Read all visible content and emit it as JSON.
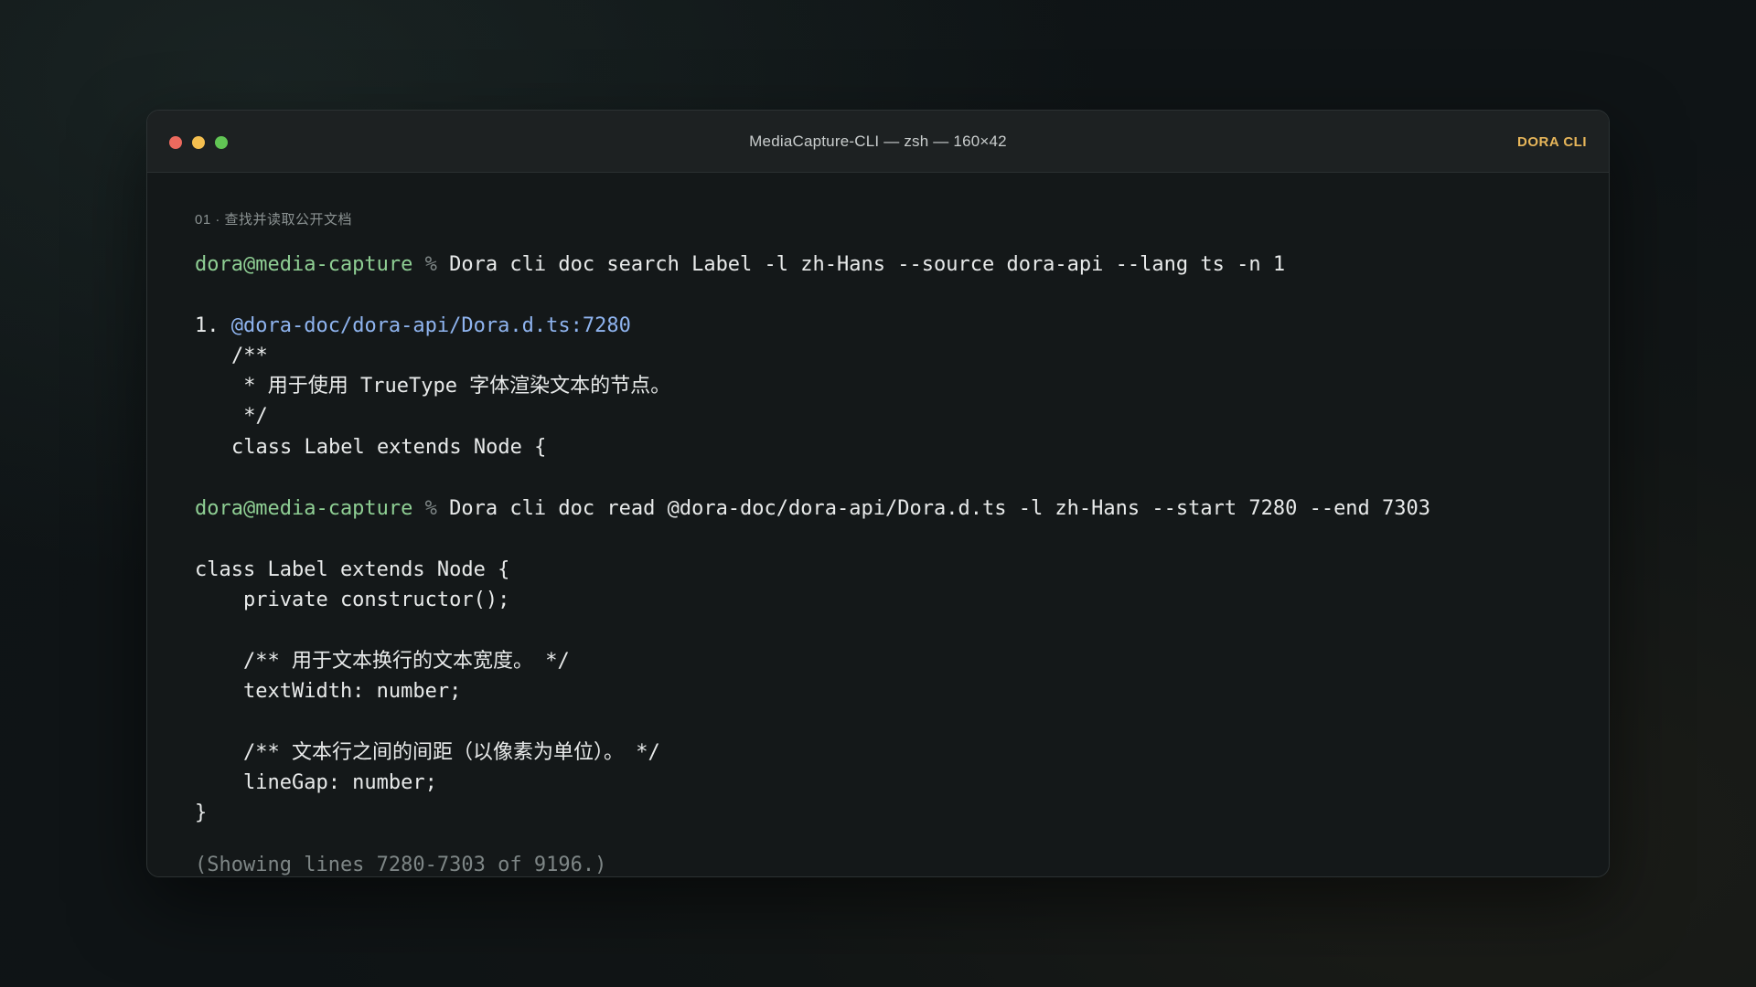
{
  "window": {
    "title": "MediaCapture-CLI — zsh — 160×42",
    "brand": "DORA CLI"
  },
  "terminal": {
    "step_label": "01 · 查找并读取公开文档",
    "commands": [
      {
        "prompt": "dora@media-capture",
        "symbol": "%",
        "text": "Dora cli doc search Label -l zh-Hans --source dora-api --lang ts -n 1"
      },
      {
        "prompt": "dora@media-capture",
        "symbol": "%",
        "text": "Dora cli doc read @dora-doc/dora-api/Dora.d.ts -l zh-Hans --start 7280 --end 7303"
      }
    ],
    "search_result": {
      "index": "1.",
      "path": "@dora-doc/dora-api/Dora.d.ts:7280",
      "lines": [
        "/**",
        " * 用于使用 TrueType 字体渲染文本的节点。",
        " */",
        "class Label extends Node {"
      ]
    },
    "read_output": [
      "class Label extends Node {",
      "    private constructor();",
      "",
      "    /** 用于文本换行的文本宽度。 */",
      "    textWidth: number;",
      "",
      "    /** 文本行之间的间距（以像素为单位）。 */",
      "    lineGap: number;",
      "}"
    ],
    "footer": "(Showing lines 7280-7303 of 9196.)"
  },
  "colors": {
    "prompt": "#8fcf94",
    "link": "#8fb4ef",
    "brand": "#e7b65a",
    "close": "#ec6a5e",
    "minimize": "#f4bf4f",
    "maximize": "#61c554"
  }
}
